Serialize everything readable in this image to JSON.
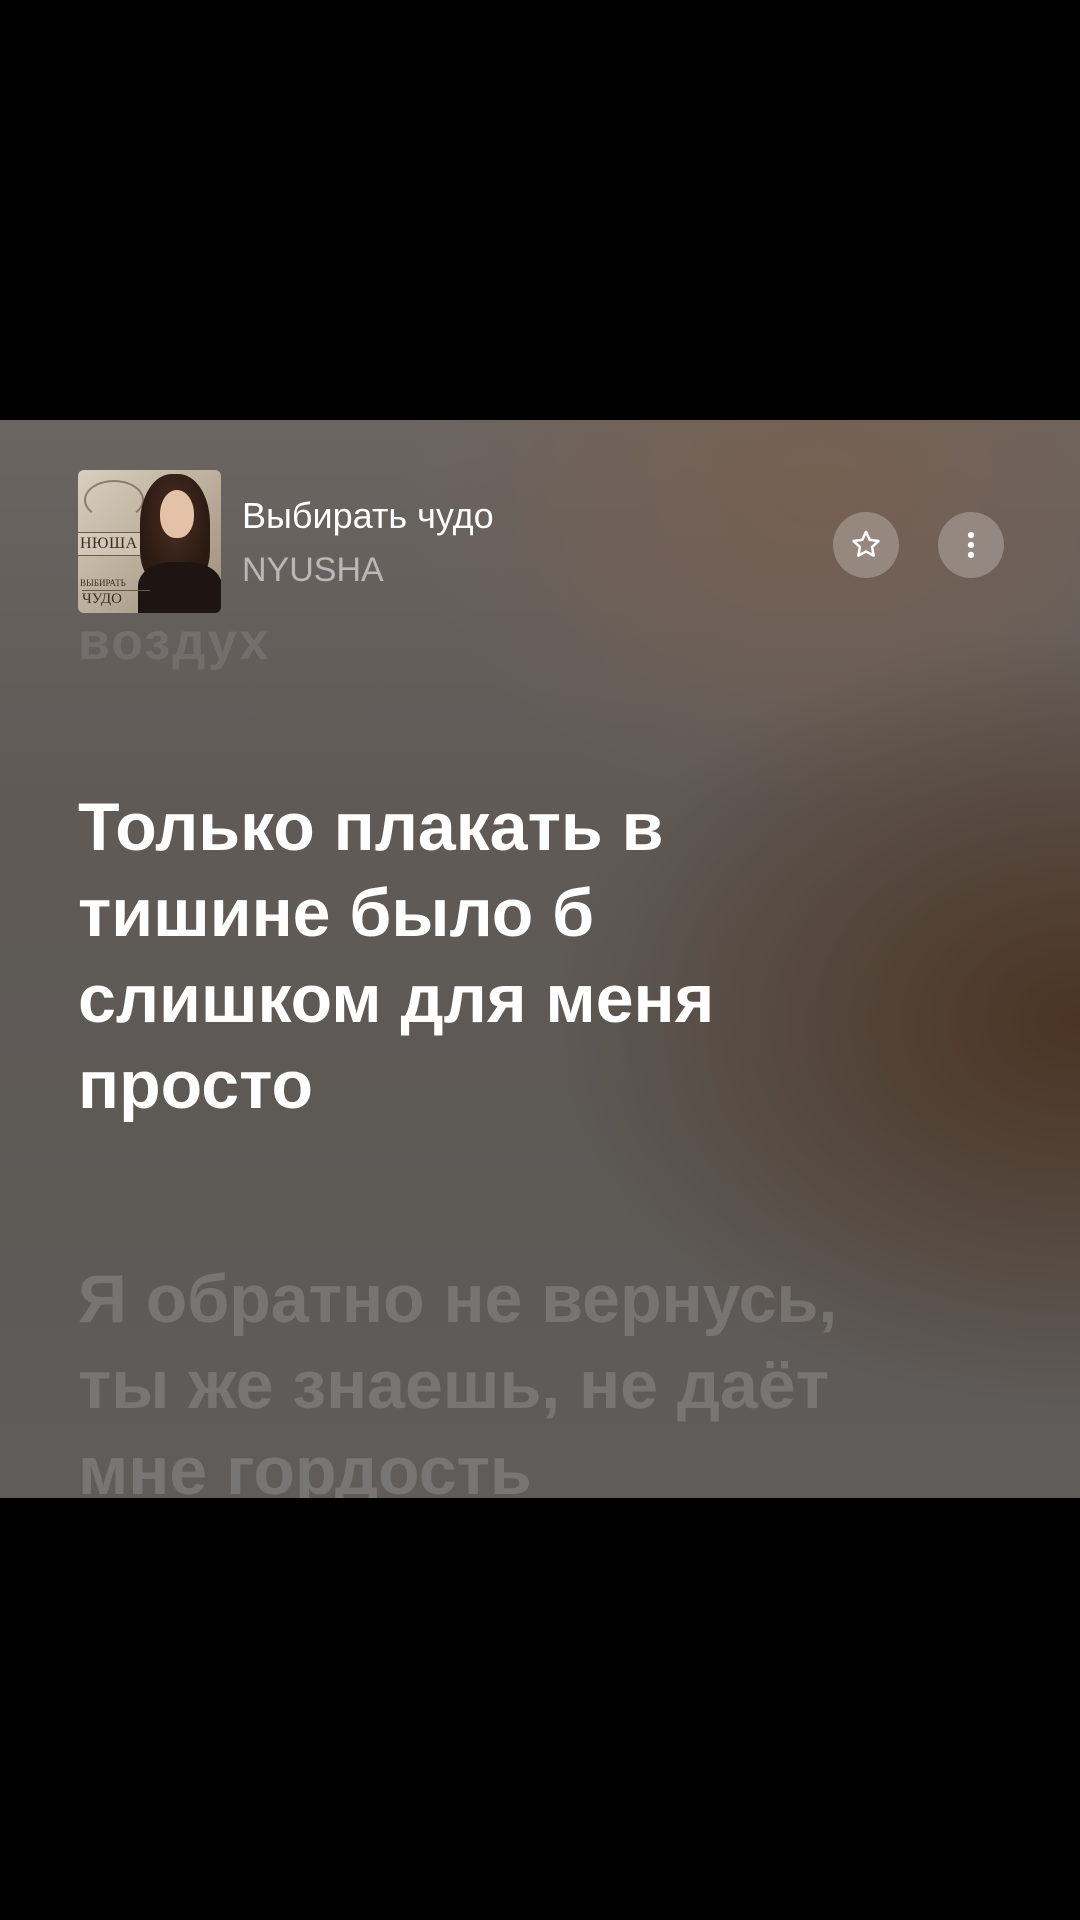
{
  "track": {
    "title": "Выбирать чудо",
    "artist": "NYUSHA"
  },
  "album_art": {
    "label": "НЮША",
    "subtitle_small": "ВЫБИРАТЬ",
    "subtitle_large": "ЧУДО"
  },
  "buttons": {
    "favorite_icon": "star-icon",
    "more_icon": "vertical-ellipsis-icon"
  },
  "lyrics": {
    "previous": "воздух",
    "current": "Только плакать в\nтишине было б\nслишком для меня\nпросто",
    "next": "Я обратно не вернусь,\nты же знаешь, не даёт\nмне гордость"
  },
  "colors": {
    "letterbox": "#000000",
    "background": "#615b58",
    "accent_warm": "#4a3220",
    "text_primary": "#ffffff"
  }
}
